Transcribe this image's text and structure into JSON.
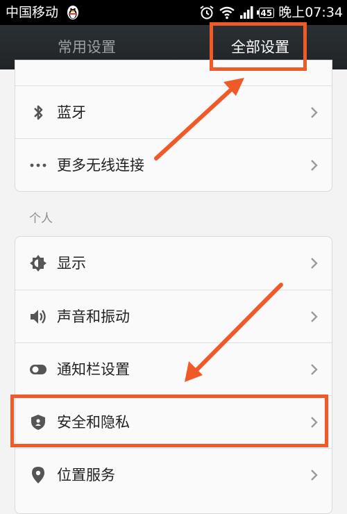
{
  "statusbar": {
    "carrier": "中国移动",
    "battery": "45",
    "time": "晚上07:34"
  },
  "tabs": {
    "common": "常用设置",
    "all": "全部设置"
  },
  "wireless": {
    "items": [
      {
        "label": "蓝牙",
        "icon": "bluetooth-icon"
      },
      {
        "label": "更多无线连接",
        "icon": "more-dots-icon"
      }
    ]
  },
  "personal": {
    "section_title": "个人",
    "items": [
      {
        "label": "显示",
        "icon": "brightness-icon"
      },
      {
        "label": "声音和振动",
        "icon": "speaker-icon"
      },
      {
        "label": "通知栏设置",
        "icon": "toggle-icon"
      },
      {
        "label": "安全和隐私",
        "icon": "shield-icon"
      },
      {
        "label": "位置服务",
        "icon": "location-pin-icon"
      }
    ]
  },
  "colors": {
    "annotation": "#f05a28",
    "header_bg": "#23272a",
    "page_bg": "#f3f3f3"
  }
}
